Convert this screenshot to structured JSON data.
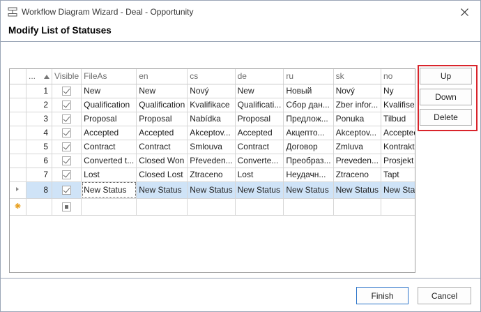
{
  "window": {
    "title": "Workflow Diagram Wizard - Deal - Opportunity",
    "heading": "Modify List of Statuses"
  },
  "grid": {
    "columns": [
      "...",
      "Visible",
      "FileAs",
      "en",
      "cs",
      "de",
      "ru",
      "sk",
      "no"
    ],
    "rows": [
      {
        "num": "1",
        "visible": true,
        "cells": [
          "New",
          "New",
          "Nový",
          "New",
          "Новый",
          "Nový",
          "Ny"
        ]
      },
      {
        "num": "2",
        "visible": true,
        "cells": [
          "Qualification",
          "Qualification",
          "Kvalifikace",
          "Qualificati...",
          "Сбор дан...",
          "Zber infor...",
          "Kvalifisering"
        ]
      },
      {
        "num": "3",
        "visible": true,
        "cells": [
          "Proposal",
          "Proposal",
          "Nabídka",
          "Proposal",
          "Предлож...",
          "Ponuka",
          "Tilbud"
        ]
      },
      {
        "num": "4",
        "visible": true,
        "cells": [
          "Accepted",
          "Accepted",
          "Akceptov...",
          "Accepted",
          "Акцепто...",
          "Akceptov...",
          "Accepted"
        ]
      },
      {
        "num": "5",
        "visible": true,
        "cells": [
          "Contract",
          "Contract",
          "Smlouva",
          "Contract",
          "Договор",
          "Zmluva",
          "Kontrakt"
        ]
      },
      {
        "num": "6",
        "visible": true,
        "cells": [
          "Converted t...",
          "Closed Won",
          "Převeden...",
          "Converte...",
          "Преобраз...",
          "Preveden...",
          "Prosjekt"
        ]
      },
      {
        "num": "7",
        "visible": true,
        "cells": [
          "Lost",
          "Closed Lost",
          "Ztraceno",
          "Lost",
          "Неудачн...",
          "Ztraceno",
          "Tapt"
        ]
      },
      {
        "num": "8",
        "visible": true,
        "cells": [
          "New Status",
          "New Status",
          "New Status",
          "New Status",
          "New Status",
          "New Status",
          "New Status"
        ]
      }
    ]
  },
  "side_buttons": {
    "up": "Up",
    "down": "Down",
    "delete": "Delete"
  },
  "footer": {
    "finish": "Finish",
    "cancel": "Cancel"
  },
  "colors": {
    "selection": "#cfe3f7",
    "highlight_border": "#d9242b",
    "primary_border": "#2b73c9",
    "new_row_icon": "#e8a020"
  }
}
